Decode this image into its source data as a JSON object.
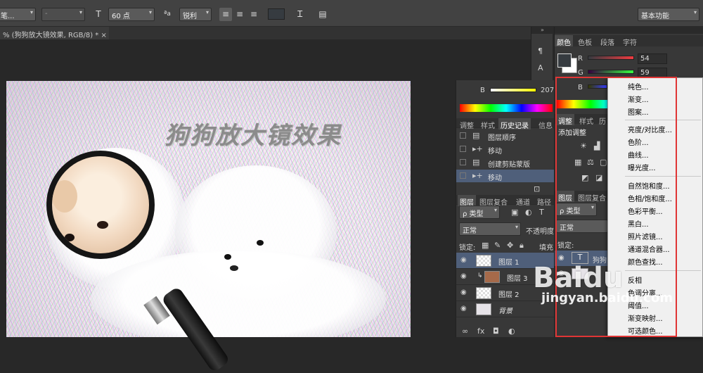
{
  "optbar": {
    "tool_label": "笔...",
    "font_style": "-",
    "size": "60 点",
    "antialias": "锐利",
    "workspace": "基本功能"
  },
  "doc": {
    "tab": "% (狗狗放大镜效果, RGB/8) *",
    "close": "×"
  },
  "artwork": {
    "title": "狗狗放大镜效果"
  },
  "history_panel": {
    "b_label": "B",
    "b_value": "207",
    "tabs": [
      "调整",
      "样式",
      "历史记录",
      "信息"
    ],
    "items": [
      {
        "icon": "document",
        "label": "图层顺序"
      },
      {
        "icon": "move",
        "label": "移动"
      },
      {
        "icon": "document",
        "label": "创建剪贴蒙版"
      },
      {
        "icon": "move",
        "label": "移动"
      }
    ]
  },
  "layers_panel": {
    "tabs": [
      "图层",
      "图层复合",
      "通道",
      "路径"
    ],
    "kind_filter": "ρ 类型",
    "blend_mode": "正常",
    "opacity_label": "不透明度",
    "lock_label": "锁定:",
    "fill_label": "填充",
    "layers": [
      {
        "name": "图层 1",
        "selected": true
      },
      {
        "name": "图层 3",
        "selected": false
      },
      {
        "name": "图层 2",
        "selected": false
      },
      {
        "name": "背景",
        "selected": false
      }
    ]
  },
  "color_panel": {
    "tabs": [
      "颜色",
      "色板",
      "段落",
      "字符"
    ],
    "r_label": "R",
    "r_value": "54",
    "g_label": "G",
    "g_value": "59",
    "b_label": "B"
  },
  "adjust_panel": {
    "tabs": [
      "调整",
      "样式",
      "历"
    ],
    "title": "添加调整"
  },
  "layers_panel2": {
    "tabs": [
      "图层",
      "图层复合"
    ],
    "kind_filter": "ρ 类型",
    "blend_mode": "正常",
    "lock_label": "锁定:",
    "layer_text": "狗狗"
  },
  "context_menu": {
    "items": [
      "纯色...",
      "渐变...",
      "图案...",
      "亮度/对比度...",
      "色阶...",
      "曲线...",
      "曝光度...",
      "自然饱和度...",
      "色相/饱和度...",
      "色彩平衡...",
      "黑白...",
      "照片滤镜...",
      "通道混合器...",
      "颜色查找...",
      "反相",
      "色调分离...",
      "阈值...",
      "渐变映射...",
      "可选颜色..."
    ]
  },
  "watermark": {
    "logo": "Baidu",
    "url": "jingyan.baidu.com"
  },
  "colors": {
    "accent_red": "#e03535",
    "selected_row": "#4f5f7a"
  }
}
